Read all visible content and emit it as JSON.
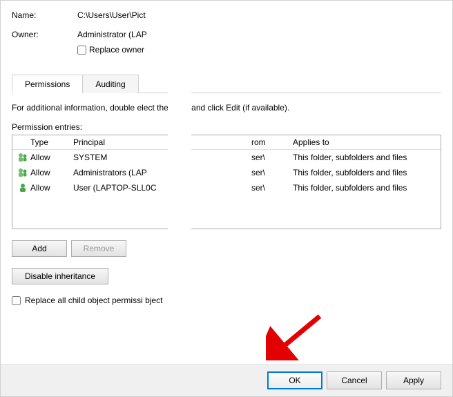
{
  "name_label": "Name:",
  "name_value": "C:\\Users\\User\\Pict",
  "owner_label": "Owner:",
  "owner_value": "Administrator (LAP",
  "replace_owner_label": "Replace owner",
  "tabs": {
    "permissions": "Permissions",
    "auditing": "Auditing"
  },
  "instructions": "For additional information, double          elect the entry and click Edit (if available).",
  "entries_label": "Permission entries:",
  "columns": {
    "type": "Type",
    "principal": "Principal",
    "from": "rom",
    "applies": "Applies to"
  },
  "rows": [
    {
      "type": "Allow",
      "principal": "SYSTEM",
      "from": "ser\\",
      "applies": "This folder, subfolders and files"
    },
    {
      "type": "Allow",
      "principal": "Administrators (LAP",
      "from": "ser\\",
      "applies": "This folder, subfolders and files"
    },
    {
      "type": "Allow",
      "principal": "User (LAPTOP-SLL0C",
      "from": "ser\\",
      "applies": "This folder, subfolders and files"
    }
  ],
  "buttons": {
    "add": "Add",
    "remove": "Remove",
    "disable_inherit": "Disable inheritance",
    "ok": "OK",
    "cancel": "Cancel",
    "apply": "Apply"
  },
  "replace_child_label": "Replace all child object permissi        bject"
}
